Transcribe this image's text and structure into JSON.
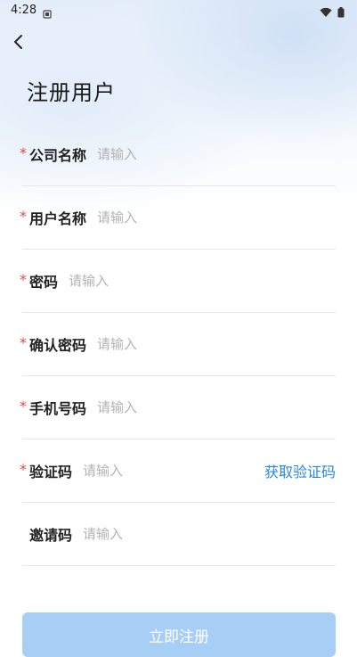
{
  "status_bar": {
    "time": "4:28"
  },
  "header": {
    "title": "注册用户"
  },
  "form": {
    "required_mark": "*",
    "placeholder": "请输入",
    "fields": {
      "company": {
        "label": "公司名称"
      },
      "username": {
        "label": "用户名称"
      },
      "password": {
        "label": "密码"
      },
      "confirm_password": {
        "label": "确认密码"
      },
      "phone": {
        "label": "手机号码"
      },
      "verification_code": {
        "label": "验证码",
        "action": "获取验证码"
      },
      "invite_code": {
        "label": "邀请码"
      }
    }
  },
  "submit": {
    "label": "立即注册"
  },
  "colors": {
    "accent": "#2a86e0",
    "required": "#e04848",
    "submit_bg": "#a7cff6"
  }
}
